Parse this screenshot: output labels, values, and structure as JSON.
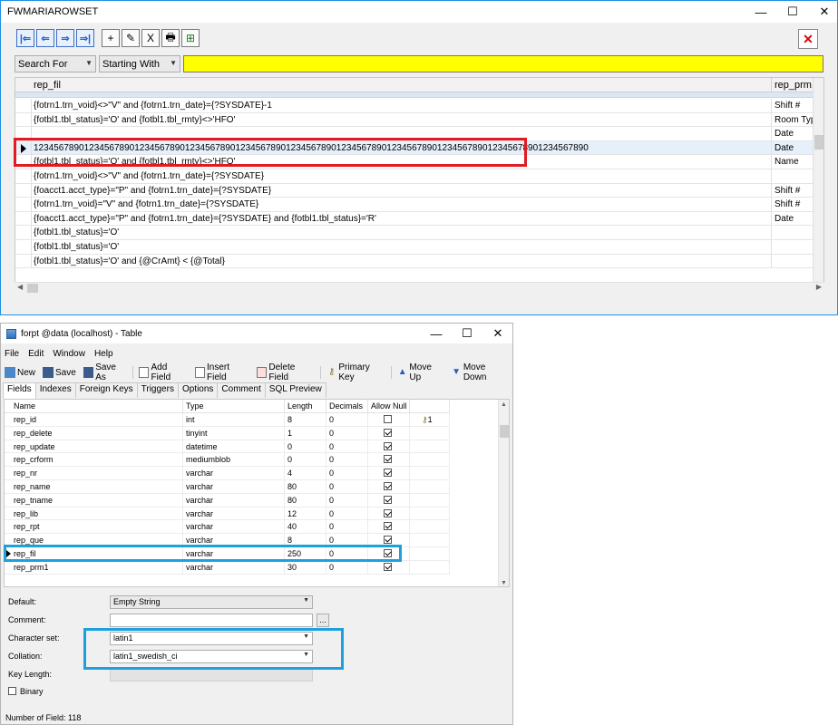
{
  "win1": {
    "title": "FWMARIAROWSET",
    "controls": {
      "minimize": "—",
      "maximize": "☐",
      "close": "✕"
    },
    "toolbar": [
      "|⇐",
      "⇐",
      "⇒",
      "⇒|",
      "+",
      "✎",
      "X",
      "🖶",
      "⊞"
    ],
    "close_button": "✕",
    "search_for": "Search For",
    "starting_with": "Starting With",
    "grid": {
      "col1": "rep_fil",
      "col2": "rep_prm1",
      "rows": [
        {
          "c1": "{fotrn1.trn_void}<>\"V\" and {fotrn1.trn_date}={?SYSDATE}-1",
          "c2": "Shift #"
        },
        {
          "c1": "{fotbl1.tbl_status}='O' and {fotbl1.tbl_rmty}<>'HFO'",
          "c2": "Room Typ"
        },
        {
          "c1": "",
          "c2": "Date"
        },
        {
          "c1": "12345678901234567890123456789012345678901234567890123456789012345678901234567890123456789012345678901234567890",
          "c2": "Date",
          "selected": true
        },
        {
          "c1": "{fotbl1.tbl_status}='O' and {fotbl1.tbl_rmty}<>'HFO'",
          "c2": "Name"
        },
        {
          "c1": "{fotrn1.trn_void}<>\"V\" and {fotrn1.trn_date}={?SYSDATE}",
          "c2": ""
        },
        {
          "c1": "{foacct1.acct_type}=\"P\" and {fotrn1.trn_date}={?SYSDATE}",
          "c2": "Shift #"
        },
        {
          "c1": "{fotrn1.trn_void}=\"V\" and {fotrn1.trn_date}={?SYSDATE}",
          "c2": "Shift #"
        },
        {
          "c1": "{foacct1.acct_type}=\"P\" and {fotrn1.trn_date}={?SYSDATE} and {fotbl1.tbl_status}='R'",
          "c2": "Date"
        },
        {
          "c1": "{fotbl1.tbl_status}='O'",
          "c2": ""
        },
        {
          "c1": "{fotbl1.tbl_status}='O'",
          "c2": ""
        },
        {
          "c1": "{fotbl1.tbl_status}='O' and {@CrAmt} < {@Total}",
          "c2": ""
        }
      ]
    }
  },
  "win2": {
    "title": "forpt @data (localhost) - Table",
    "menu": [
      "File",
      "Edit",
      "Window",
      "Help"
    ],
    "toolbar": [
      "New",
      "Save",
      "Save As",
      "Add Field",
      "Insert Field",
      "Delete Field",
      "Primary Key",
      "Move Up",
      "Move Down"
    ],
    "tabs": [
      "Fields",
      "Indexes",
      "Foreign Keys",
      "Triggers",
      "Options",
      "Comment",
      "SQL Preview"
    ],
    "columns": [
      "Name",
      "Type",
      "Length",
      "Decimals",
      "Allow Null"
    ],
    "fields": [
      {
        "name": "rep_id",
        "type": "int",
        "length": "8",
        "decimals": "0",
        "allow_null": false,
        "key": "1"
      },
      {
        "name": "rep_delete",
        "type": "tinyint",
        "length": "1",
        "decimals": "0",
        "allow_null": true,
        "key": ""
      },
      {
        "name": "rep_update",
        "type": "datetime",
        "length": "0",
        "decimals": "0",
        "allow_null": true,
        "key": ""
      },
      {
        "name": "rep_crform",
        "type": "mediumblob",
        "length": "0",
        "decimals": "0",
        "allow_null": true,
        "key": ""
      },
      {
        "name": "rep_nr",
        "type": "varchar",
        "length": "4",
        "decimals": "0",
        "allow_null": true,
        "key": ""
      },
      {
        "name": "rep_name",
        "type": "varchar",
        "length": "80",
        "decimals": "0",
        "allow_null": true,
        "key": ""
      },
      {
        "name": "rep_tname",
        "type": "varchar",
        "length": "80",
        "decimals": "0",
        "allow_null": true,
        "key": ""
      },
      {
        "name": "rep_lib",
        "type": "varchar",
        "length": "12",
        "decimals": "0",
        "allow_null": true,
        "key": ""
      },
      {
        "name": "rep_rpt",
        "type": "varchar",
        "length": "40",
        "decimals": "0",
        "allow_null": true,
        "key": ""
      },
      {
        "name": "rep_que",
        "type": "varchar",
        "length": "8",
        "decimals": "0",
        "allow_null": true,
        "key": ""
      },
      {
        "name": "rep_fil",
        "type": "varchar",
        "length": "250",
        "decimals": "0",
        "allow_null": true,
        "key": "",
        "selected": true
      },
      {
        "name": "rep_prm1",
        "type": "varchar",
        "length": "30",
        "decimals": "0",
        "allow_null": true,
        "key": ""
      }
    ],
    "props": {
      "default_label": "Default:",
      "default_value": "Empty String",
      "comment_label": "Comment:",
      "comment_value": "",
      "ellipsis": "...",
      "charset_label": "Character set:",
      "charset_value": "latin1",
      "collation_label": "Collation:",
      "collation_value": "latin1_swedish_ci",
      "keylength_label": "Key Length:",
      "binary_label": "Binary"
    },
    "status": "Number of Field: 118"
  },
  "colors": {
    "highlight_red": "#e21b23",
    "highlight_blue": "#1ea0dc",
    "search_yellow": "#ffff00",
    "title_border": "#1e90e6"
  }
}
